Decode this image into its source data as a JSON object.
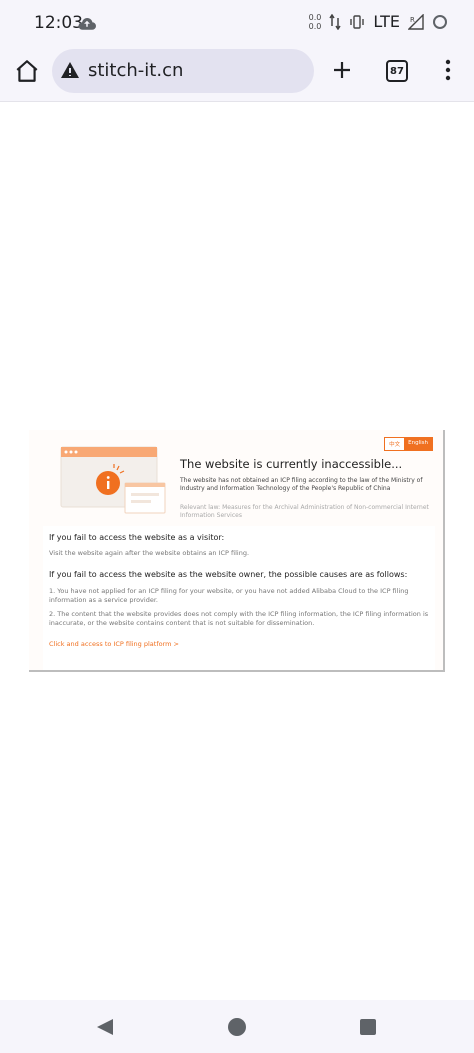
{
  "status_bar": {
    "time": "12:03",
    "data_up": "0.0",
    "data_down": "0.0",
    "network": "LTE",
    "icons": [
      "cloud-upload-icon",
      "data-arrows-icon",
      "vibrate-icon",
      "signal-icon",
      "battery-icon"
    ]
  },
  "browser": {
    "url": "stitch-it.cn",
    "tab_count": "87",
    "icons": [
      "home-icon",
      "warning-icon",
      "plus-icon",
      "more-vert-icon"
    ]
  },
  "page": {
    "lang_zh": "中文",
    "lang_en": "English",
    "headline": "The website is currently inaccessible...",
    "description": "The website has not obtained an ICP filing according to the law of the Ministry of Industry and Information Technology of the People's Republic of China",
    "law": "Relevant law: Measures for the Archival Administration of Non-commercial Internet Information Services",
    "visitor_title": "If you fail to access the website as a visitor:",
    "visitor_text": "Visit the website again after the website obtains an ICP filing.",
    "owner_title": "If you fail to access the website as the website owner, the possible causes are as follows:",
    "reason_1": "1. You have not applied for an ICP filing for your website, or you have not added Alibaba Cloud to the ICP filing information as a service provider.",
    "reason_2": "2. The content that the website provides does not comply with the ICP filing information, the ICP filing information is inaccurate, or the website contains content that is not suitable for dissemination.",
    "icp_link": "Click and access to ICP filing platform >",
    "accent_color": "#f07020"
  },
  "nav_bar": {
    "icons": [
      "back-icon",
      "home-circle-icon",
      "recents-icon"
    ]
  }
}
